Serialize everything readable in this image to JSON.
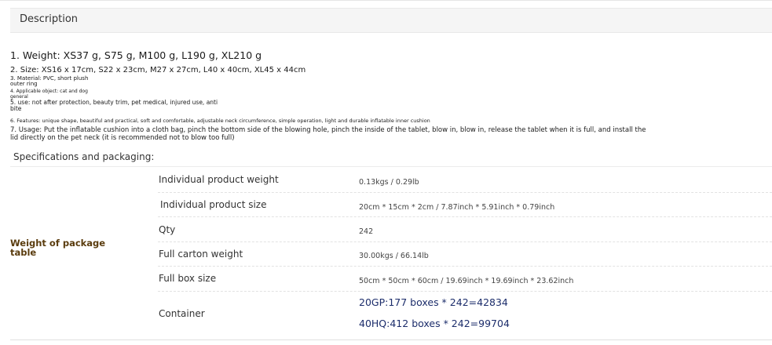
{
  "header": {
    "description_label": "Description"
  },
  "lines": {
    "weight": "1. Weight: XS37 g, S75 g, M100 g, L190 g, XL210 g",
    "size": "2. Size: XS16 x 17cm, S22 x 23cm, M27 x 27cm, L40 x 40cm, XL45 x 44cm",
    "material_a": "3. Material: PVC, short plush",
    "material_b": "outer ring",
    "applicable_a": "4. Applicable object: cat and dog",
    "applicable_b": "general",
    "use_a": "5. use: not after protection, beauty trim, pet medical, injured use, anti",
    "use_b": "bite",
    "features": "6. Features: unique shape, beautiful and practical, soft and comfortable, adjustable neck circumference, simple operation, light and durable inflatable inner cushion",
    "usage_a": "7. Usage: Put the inflatable cushion into a cloth bag, pinch the bottom side of the blowing hole, pinch the inside of the tablet, blow in, blow in, release the tablet when it is full, and install the",
    "usage_b": "lid directly on the pet neck (it is recommended not to blow too full)"
  },
  "specs": {
    "title": "Specifications and packaging:",
    "side_label": "Weight of package table",
    "rows": [
      {
        "label": "Individual product weight",
        "value": "0.13kgs / 0.29lb"
      },
      {
        "label": "Individual product size",
        "value": "20cm * 15cm * 2cm / 7.87inch * 5.91inch * 0.79inch"
      },
      {
        "label": "Qty",
        "value": "242"
      },
      {
        "label": "Full carton weight",
        "value": "30.00kgs / 66.14lb"
      },
      {
        "label": "Full box size",
        "value": "50cm * 50cm * 60cm / 19.69inch * 19.69inch * 23.62inch"
      }
    ],
    "container": {
      "label": "Container",
      "values": [
        "20GP:177 boxes * 242=42834",
        "40HQ:412 boxes * 242=99704"
      ]
    }
  }
}
